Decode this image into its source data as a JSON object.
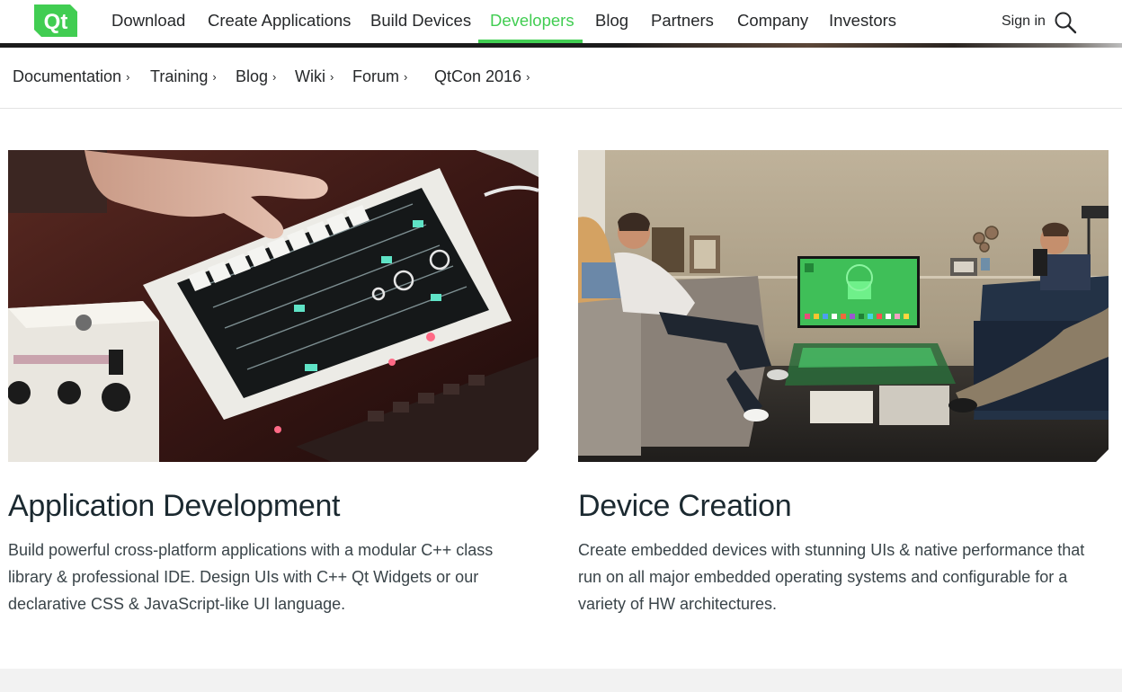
{
  "header": {
    "logo_text": "Qt",
    "nav": [
      {
        "label": "Download",
        "active": false
      },
      {
        "label": "Create Applications",
        "active": false
      },
      {
        "label": "Build Devices",
        "active": false
      },
      {
        "label": "Developers",
        "active": true
      },
      {
        "label": "Blog",
        "active": false
      },
      {
        "label": "Partners",
        "active": false
      },
      {
        "label": "Company",
        "active": false
      },
      {
        "label": "Investors",
        "active": false
      }
    ],
    "sign_in": "Sign in",
    "search_icon": "search-icon"
  },
  "subnav": {
    "items": [
      {
        "label": "Documentation"
      },
      {
        "label": "Training"
      },
      {
        "label": "Blog"
      },
      {
        "label": "Wiki"
      },
      {
        "label": "Forum"
      },
      {
        "label": "QtCon 2016"
      }
    ],
    "chevron": "›"
  },
  "cards": [
    {
      "title": "Application Development",
      "text": "Build powerful cross-platform applications with a modular C++ class library & professional IDE. Design UIs with C++ Qt Widgets or our declarative CSS & JavaScript-like UI language.",
      "image": "photo-tablet-music-controller"
    },
    {
      "title": "Device Creation",
      "text": "Create embedded devices with stunning UIs & native performance that run on all major embedded operating systems and configurable for a variety of HW architectures.",
      "image": "photo-living-room-tv"
    }
  ],
  "colors": {
    "brand_green": "#41cd52",
    "text_dark": "#1b2930",
    "footer_band": "#f2f2f2"
  }
}
